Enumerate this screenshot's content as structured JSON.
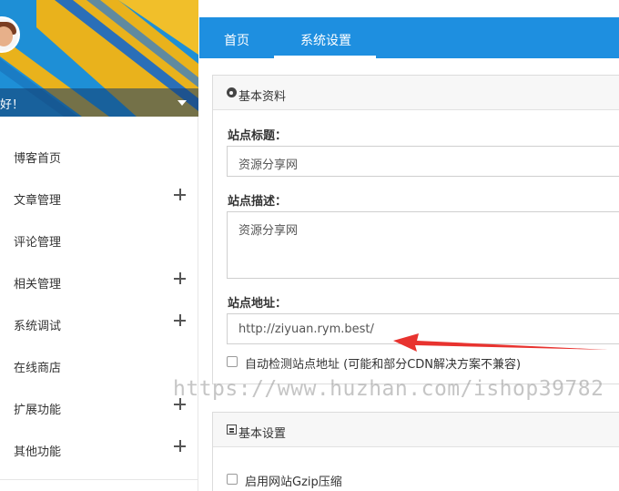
{
  "sidebar": {
    "greeting": "好！",
    "menu": [
      {
        "label": "博客首页",
        "expandable": false
      },
      {
        "label": "文章管理",
        "expandable": true
      },
      {
        "label": "评论管理",
        "expandable": false
      },
      {
        "label": "相关管理",
        "expandable": true
      },
      {
        "label": "系统调试",
        "expandable": true
      },
      {
        "label": "在线商店",
        "expandable": false
      },
      {
        "label": "扩展功能",
        "expandable": true
      },
      {
        "label": "其他功能",
        "expandable": true
      }
    ]
  },
  "topbar": {
    "tabs": [
      {
        "label": "首页",
        "active": false
      },
      {
        "label": "系统设置",
        "active": true
      }
    ]
  },
  "basic_info": {
    "title": "基本资料",
    "icon": "palette-icon",
    "site_title_label": "站点标题：",
    "site_title_value": "资源分享网",
    "site_desc_label": "站点描述：",
    "site_desc_value": "资源分享网",
    "site_url_label": "站点地址：",
    "site_url_value": "http://ziyuan.rym.best/",
    "auto_detect_label": "自动检测站点地址 (可能和部分CDN解决方案不兼容)"
  },
  "basic_settings": {
    "title": "基本设置",
    "icon": "list-icon",
    "gzip_label": "启用网站Gzip压缩"
  },
  "watermark": "https://www.huzhan.com/ishop39782",
  "colors": {
    "primary": "#1e8fe0",
    "banner_yellow": "#e9b21c",
    "arrow_red": "#e8332f"
  }
}
